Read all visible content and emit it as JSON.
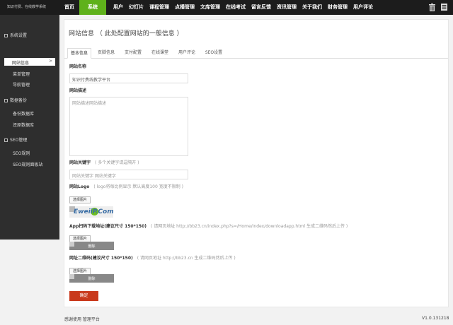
{
  "header": {
    "brand": "知识付费、在线教学系统",
    "nav": [
      "首页",
      "系统",
      "用户",
      "幻灯片",
      "课程管理",
      "点播管理",
      "文库管理",
      "在线考试",
      "留言反馈",
      "资讯管理",
      "关于我们",
      "财务管理",
      "用户评论"
    ],
    "active_index": 1,
    "accent": "#5fb11b"
  },
  "sidebar": {
    "sections": [
      {
        "label": "系统设置",
        "items": [
          "网站信息",
          "菜单管理",
          "导航管理"
        ]
      },
      {
        "label": "数据备份",
        "items": [
          "备份数据库",
          "还原数据库"
        ]
      },
      {
        "label": "SEO管理",
        "items": [
          "SEO规则",
          "SEO规则面板站"
        ]
      }
    ],
    "active_item": "网站信息",
    "active_arrow": ">"
  },
  "main": {
    "title": "网站信息 （ 此处配置网站的一般信息 ）",
    "tabs": [
      "基本信息",
      "页脚信息",
      "支付配置",
      "在线课堂",
      "用户评论",
      "SEO设置"
    ],
    "site_name": {
      "label": "网站名称",
      "value": "知识付费线教学平台"
    },
    "site_desc": {
      "label": "网站描述",
      "value": "网站描述网站描述"
    },
    "keywords": {
      "label": "网站关键字",
      "hint": "( 多个关键字请逗隔开 )",
      "value": "网站关键字 网站关键字"
    },
    "logo": {
      "label": "网站Logo",
      "hint": "( logo将每比例显示 默认高度100 宽度不限制 )",
      "button": "选择图片",
      "preview_text": "EweiiP.Com"
    },
    "app_qr": {
      "label": "App扫码下载地址(建议尺寸 150*150)",
      "hint": "( 请网页地址 http://bb23.cn/index.php?s=/Home/Index/downloadapp.html 生成二维码然后上传 )",
      "button": "选择图片",
      "delete": "删除"
    },
    "site_qr": {
      "label": "网址二维码(建议尺寸 150*150)",
      "hint": "( 请网页地址 http://bb23.cn 生成二维码然后上传 )",
      "button": "选择图片",
      "delete": "删除"
    },
    "submit": "确定",
    "submit_color": "#c9391c"
  },
  "footer": {
    "left": "感谢使用  管理平台",
    "version": "V1.0.131218"
  }
}
